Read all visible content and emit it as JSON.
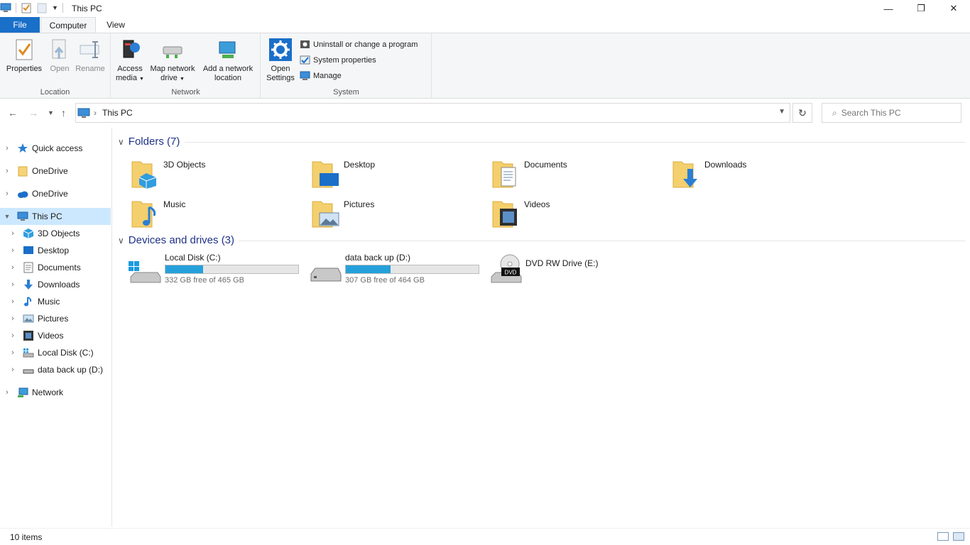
{
  "window": {
    "title": "This PC",
    "controls": {
      "minimize": "—",
      "maximize": "❐",
      "close": "✕"
    }
  },
  "ribbon": {
    "tabs": [
      {
        "label": "File"
      },
      {
        "label": "Computer"
      },
      {
        "label": "View"
      }
    ],
    "groups": {
      "location": {
        "label": "Location",
        "buttons": [
          {
            "label": "Properties"
          },
          {
            "label": "Open"
          },
          {
            "label": "Rename"
          }
        ]
      },
      "network": {
        "label": "Network",
        "buttons": [
          {
            "line1": "Access",
            "line2": "media"
          },
          {
            "line1": "Map network",
            "line2": "drive"
          },
          {
            "line1": "Add a network",
            "line2": "location"
          }
        ]
      },
      "system": {
        "label": "System",
        "open_settings": {
          "line1": "Open",
          "line2": "Settings"
        },
        "items": [
          {
            "label": "Uninstall or change a program"
          },
          {
            "label": "System properties"
          },
          {
            "label": "Manage"
          }
        ]
      }
    }
  },
  "address": {
    "path": "This PC",
    "search_placeholder": "Search This PC"
  },
  "sidebar": {
    "items": [
      {
        "label": "Quick access"
      },
      {
        "label": "OneDrive"
      },
      {
        "label": "OneDrive"
      },
      {
        "label": "This PC"
      },
      {
        "label": "3D Objects"
      },
      {
        "label": "Desktop"
      },
      {
        "label": "Documents"
      },
      {
        "label": "Downloads"
      },
      {
        "label": "Music"
      },
      {
        "label": "Pictures"
      },
      {
        "label": "Videos"
      },
      {
        "label": "Local Disk (C:)"
      },
      {
        "label": "data back up (D:)"
      },
      {
        "label": "Network"
      }
    ]
  },
  "folders": {
    "header": "Folders (7)",
    "items": [
      {
        "name": "3D Objects"
      },
      {
        "name": "Desktop"
      },
      {
        "name": "Documents"
      },
      {
        "name": "Downloads"
      },
      {
        "name": "Music"
      },
      {
        "name": "Pictures"
      },
      {
        "name": "Videos"
      }
    ]
  },
  "drives": {
    "header": "Devices and drives (3)",
    "items": [
      {
        "name": "Local Disk (C:)",
        "free": "332 GB free of 465 GB",
        "used_fraction": 0.286
      },
      {
        "name": "data back up (D:)",
        "free": "307 GB free of 464 GB",
        "used_fraction": 0.338
      },
      {
        "name": "DVD RW Drive (E:)"
      }
    ]
  },
  "status": {
    "items_count": "10 items"
  },
  "colors": {
    "accent": "#1a6fc9",
    "selection": "#cce8ff",
    "bar_fill": "#26a0da",
    "header_text": "#1e3287"
  }
}
